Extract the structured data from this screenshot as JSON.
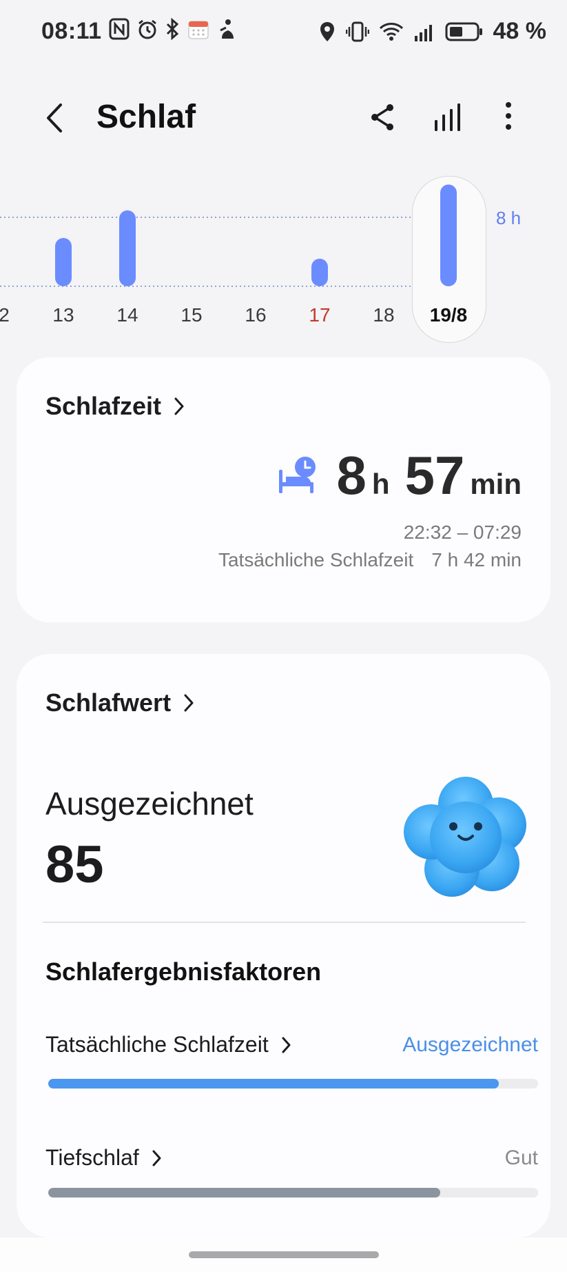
{
  "status": {
    "time": "08:11",
    "battery": "48 %",
    "icons_left": [
      "nfc-icon",
      "alarm-icon",
      "bluetooth-icon",
      "calendar-icon",
      "figure-icon"
    ],
    "icons_right": [
      "location-icon",
      "vibrate-icon",
      "wifi-icon",
      "signal-icon",
      "battery-icon"
    ]
  },
  "appbar": {
    "title": "Schlaf",
    "actions": [
      "back-icon",
      "share-icon",
      "bar-chart-icon",
      "more-icon"
    ]
  },
  "chart_data": {
    "type": "bar",
    "categories": [
      "2",
      "13",
      "14",
      "15",
      "16",
      "17",
      "18",
      "19/8"
    ],
    "values": [
      null,
      7.4,
      8.2,
      null,
      null,
      6.8,
      null,
      8.95
    ],
    "reference_line_label": "8 h",
    "selected": "19/8",
    "highlight_day": "17",
    "bar_color": "#6b8cff"
  },
  "sleep_time": {
    "title": "Schlafzeit",
    "hours": "8",
    "hours_unit": "h",
    "minutes": "57",
    "minutes_unit": "min",
    "range": "22:32 – 07:29",
    "actual_label": "Tatsächliche Schlafzeit",
    "actual_value": "7 h 42 min"
  },
  "sleep_score": {
    "title": "Schlafwert",
    "rating": "Ausgezeichnet",
    "score": "85",
    "factors_title": "Schlafergebnisfaktoren",
    "factors": [
      {
        "name": "Tatsächliche Schlafzeit",
        "status": "Ausgezeichnet",
        "fill": 0.92,
        "color": "#4a96f0",
        "status_color": "#4a8fe7"
      },
      {
        "name": "Tiefschlaf",
        "status": "Gut",
        "fill": 0.8,
        "color": "#8a949e",
        "status_color": "#8a8a8a"
      }
    ]
  },
  "colors": {
    "accent": "#6b8cff",
    "sunday": "#c0392b",
    "excellent": "#4a96f0"
  }
}
